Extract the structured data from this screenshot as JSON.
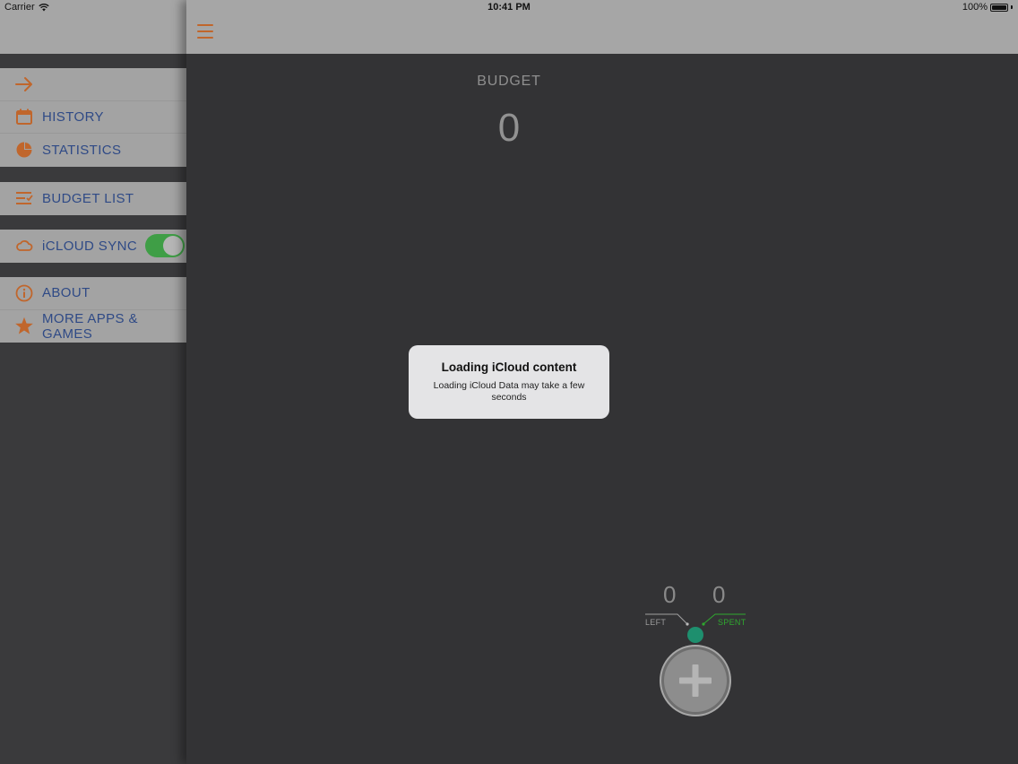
{
  "status_bar": {
    "carrier": "Carrier",
    "time": "10:41 PM",
    "battery": "100%"
  },
  "sidebar": {
    "items": [
      {
        "id": "back",
        "icon": "arrow-right-icon",
        "label": ""
      },
      {
        "id": "history",
        "icon": "calendar-icon",
        "label": "HISTORY"
      },
      {
        "id": "statistics",
        "icon": "pie-chart-icon",
        "label": "STATISTICS"
      },
      {
        "id": "budget_list",
        "icon": "list-icon",
        "label": "BUDGET LIST"
      },
      {
        "id": "icloud_sync",
        "icon": "cloud-icon",
        "label": "iCLOUD SYNC",
        "toggle_on": true
      },
      {
        "id": "about",
        "icon": "info-icon",
        "label": "ABOUT"
      },
      {
        "id": "more_apps",
        "icon": "star-icon",
        "label": "MORE APPS & GAMES"
      }
    ]
  },
  "main": {
    "menu_icon": "hamburger-icon",
    "budget_label": "BUDGET",
    "budget_value": "0",
    "left_value": "0",
    "left_label": "LEFT",
    "spent_value": "0",
    "spent_label": "SPENT",
    "add_icon": "plus-icon"
  },
  "alert": {
    "title": "Loading iCloud content",
    "message": "Loading iCloud Data may take a few seconds"
  },
  "colors": {
    "accent": "#c0662c",
    "menu_text": "#2f4a86",
    "toggle_on": "#3f9e46",
    "spent_green": "#2fa82f",
    "dot_teal": "#1e8f6e"
  }
}
